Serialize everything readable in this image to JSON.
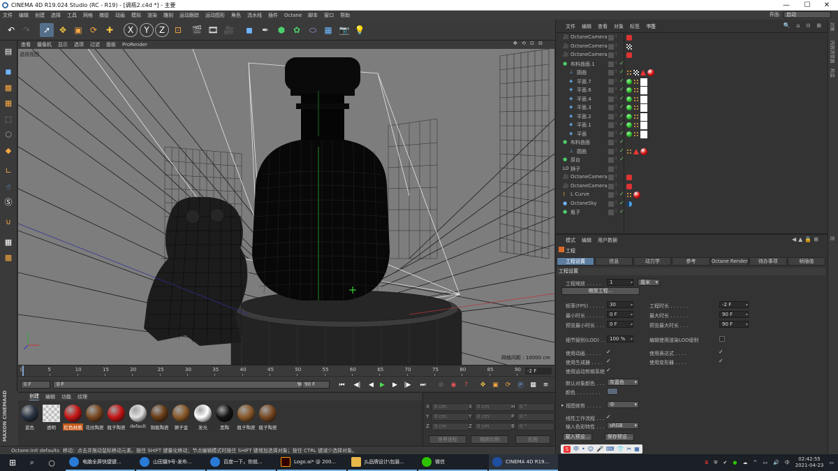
{
  "window": {
    "title": "CINEMA 4D R19.024 Studio (RC - R19) - [调瓶2.c4d *] - 主要",
    "min": "—",
    "max": "☐",
    "close": "✕"
  },
  "menu": [
    "文件",
    "编辑",
    "创建",
    "选择",
    "工具",
    "网格",
    "捕捉",
    "动画",
    "模拟",
    "渲染",
    "雕刻",
    "运动跟踪",
    "运动图形",
    "角色",
    "流水线",
    "插件",
    "Octane",
    "脚本",
    "窗口",
    "帮助"
  ],
  "interface": {
    "label": "界面:",
    "value": "启动"
  },
  "viewport": {
    "menu": [
      "查看",
      "摄像机",
      "显示",
      "选项",
      "过滤",
      "面板",
      "ProRender"
    ],
    "nav": "✥ ⟲ ⊡ ⊟",
    "label": "透视视图",
    "grid_space": "网格间距 : 10000 cm"
  },
  "timeline": {
    "ticks": [
      "0",
      "5",
      "10",
      "15",
      "20",
      "25",
      "30",
      "35",
      "40",
      "45",
      "50",
      "55",
      "60",
      "65",
      "70",
      "75",
      "80",
      "85",
      "90"
    ],
    "current_frame": "-2 F"
  },
  "playback": {
    "start": "0 F",
    "range_start": "0 F",
    "range_end": "90 F",
    "end": "90 F"
  },
  "materials": {
    "menu": [
      "创建",
      "编辑",
      "功能",
      "纹理"
    ],
    "items": [
      {
        "label": "蓝色",
        "color": "#2a3442",
        "active": false
      },
      {
        "label": "透明",
        "color": "checker",
        "active": false
      },
      {
        "label": "红色材质",
        "color": "#c81818",
        "active": true
      },
      {
        "label": "花纹陶瓷",
        "color": "#7a4a22",
        "active": false
      },
      {
        "label": "瓶子陶瓷",
        "color": "#c81818",
        "active": false
      },
      {
        "label": "default",
        "color": "#e0e0e0",
        "active": false
      },
      {
        "label": "铜瓶陶瓷",
        "color": "#6b3e18",
        "active": false
      },
      {
        "label": "狮子金",
        "color": "#8a5a2a",
        "active": false
      },
      {
        "label": "发光",
        "color": "#ffffff",
        "active": false
      },
      {
        "label": "黑陶",
        "color": "#151515",
        "active": false
      },
      {
        "label": "瓶子陶瓷",
        "color": "#8a5a2a",
        "active": false
      },
      {
        "label": "瓶子陶瓷",
        "color": "#7a4a22",
        "active": false
      }
    ]
  },
  "coords": {
    "rows": [
      {
        "a": "X",
        "av": "0 cm",
        "b": "X",
        "bv": "0 cm",
        "c": "H",
        "cv": "0 °"
      },
      {
        "a": "Y",
        "av": "0 cm",
        "b": "Y",
        "bv": "0 cm",
        "c": "P",
        "cv": "0 °"
      },
      {
        "a": "Z",
        "av": "0 cm",
        "b": "Z",
        "bv": "0 cm",
        "c": "B",
        "cv": "0 °"
      }
    ],
    "mode1": "世界坐标",
    "mode2": "缩放比例",
    "apply": "应用"
  },
  "status": {
    "left": "Octane:init defaults",
    "message": "移动：点击并拖动鼠标移动元素。按住 SHIFT 键量化移动；节点编辑模式时按住 SHIFT 键增加选择对象；按住 CTRL 键减少选择对象。"
  },
  "objects": {
    "menu": [
      "文件",
      "编辑",
      "查看",
      "对象",
      "标签",
      "书签"
    ],
    "icons": "🔍 ⌂ ⊙ ⊞",
    "rows": [
      {
        "name": "OctaneCamera",
        "indent": 0,
        "type": "camera",
        "tags": [
          "cam"
        ]
      },
      {
        "name": "OctaneCamera",
        "indent": 0,
        "type": "camera",
        "tags": [
          "check"
        ]
      },
      {
        "name": "OctaneCamera",
        "indent": 0,
        "type": "camera",
        "tags": [
          "cam"
        ]
      },
      {
        "name": "布料曲面.1",
        "indent": 0,
        "type": "cloth",
        "tags": []
      },
      {
        "name": "圆曲",
        "indent": 1,
        "type": "shape",
        "tags": [
          "dots",
          "checker",
          "tri",
          "red"
        ]
      },
      {
        "name": "平面.7",
        "indent": 1,
        "type": "plane",
        "tags": [
          "green",
          "dots",
          "white"
        ]
      },
      {
        "name": "平面.6",
        "indent": 1,
        "type": "plane",
        "tags": [
          "green",
          "dots",
          "white"
        ]
      },
      {
        "name": "平面.4",
        "indent": 1,
        "type": "plane",
        "tags": [
          "green",
          "dots",
          "white"
        ]
      },
      {
        "name": "平面.3",
        "indent": 1,
        "type": "plane",
        "tags": [
          "green",
          "dots",
          "white"
        ]
      },
      {
        "name": "平面.2",
        "indent": 1,
        "type": "plane",
        "tags": [
          "green",
          "dots",
          "white"
        ]
      },
      {
        "name": "平面.1",
        "indent": 1,
        "type": "plane",
        "tags": [
          "green",
          "dots",
          "white"
        ]
      },
      {
        "name": "平面",
        "indent": 1,
        "type": "plane",
        "tags": [
          "green",
          "dots",
          "white"
        ]
      },
      {
        "name": "布料曲面",
        "indent": 0,
        "type": "cloth",
        "tags": []
      },
      {
        "name": "圆曲",
        "indent": 1,
        "type": "shape",
        "tags": [
          "dots",
          "tri",
          "red"
        ]
      },
      {
        "name": "原台",
        "indent": 0,
        "type": "cloth",
        "tags": []
      },
      {
        "name": "狮子",
        "indent": 0,
        "type": "null",
        "tags": []
      },
      {
        "name": "OctaneCamera",
        "indent": 0,
        "type": "camera",
        "tags": [
          "cam"
        ]
      },
      {
        "name": "OctaneCamera",
        "indent": 0,
        "type": "camera",
        "tags": [
          "cam"
        ]
      },
      {
        "name": "L Curve",
        "indent": 0,
        "type": "curve",
        "tags": [
          "dots",
          "red"
        ]
      },
      {
        "name": "OctaneSky",
        "indent": 0,
        "type": "sky",
        "tags": [
          "sky"
        ]
      },
      {
        "name": "瓶子",
        "indent": 0,
        "type": "cloth",
        "tags": []
      }
    ]
  },
  "attributes": {
    "menu": [
      "模式",
      "编辑",
      "用户数据"
    ],
    "title": "工程",
    "tabs": [
      "工程设置",
      "信息",
      "动力学",
      "参考",
      "Octane Render",
      "待办事项",
      "帧插值"
    ],
    "section": "工程设置",
    "scale_label": "工程缩放 . . . . .",
    "scale_value": "1",
    "scale_unit": "厘米",
    "scale_button": "缩放工程...",
    "fps_label": "帧率(FPS) . . . . .",
    "fps_value": "30",
    "project_time_label": "工程时长 . . . . . .",
    "project_time_value": "-2 F",
    "min_time_label": "最小时长 . . . . . .",
    "min_time_value": "0 F",
    "max_time_label": "最大时长 . . . . . .",
    "max_time_value": "90 F",
    "preview_min_label": "预览最小时长 . . .",
    "preview_min_value": "0 F",
    "preview_max_label": "预览最大时长 . . .",
    "preview_max_value": "90 F",
    "lod_label": "细节级别(LOD) . . .",
    "lod_value": "100 %",
    "render_lod_label": "编辑使用渲染LOD级别",
    "use_anim_label": "使用动画 . . . . .",
    "use_expr_label": "使用表达式 . . . .",
    "use_gen_label": "使用生成器 . . . .",
    "use_deform_label": "使用变形器 . . . .",
    "use_motion_label": "使用运动剪辑系统",
    "default_color_label": "默认对象颜色 . . .",
    "default_color_value": "灰蓝色",
    "color_label": "颜色 . . . . . . . .",
    "view_clip_label": "视图修剪 . . . . .",
    "view_clip_value": "中",
    "linear_label": "线性工作流程 . . .",
    "input_color_label": "输入色彩特性 . . .",
    "input_color_value": "sRGB",
    "load_preset": "载入预设...",
    "save_preset": "保存预设..."
  },
  "right_tabs": [
    "对象",
    "内容浏览器",
    "构造",
    "层"
  ],
  "ime": [
    "中",
    "•",
    "☺",
    "🎤",
    "⌨",
    "👕",
    "✂",
    "▦"
  ],
  "taskbar": {
    "items": [
      {
        "label": "电脑全屏快捷键...",
        "color": "#2a7bd6",
        "state": "open"
      },
      {
        "label": "山田摄9号-发布...",
        "color": "#2a7bd6",
        "state": "open"
      },
      {
        "label": "百度一下，你就...",
        "color": "#2a7bd6",
        "state": "open"
      },
      {
        "label": "Logo.ai* @ 200...",
        "color": "#330000",
        "state": "open"
      },
      {
        "label": "JL品牌设计\\包装...",
        "color": "#e8b84a",
        "state": "open"
      },
      {
        "label": "微信",
        "color": "#2dc100",
        "state": "open"
      },
      {
        "label": "CINEMA 4D R19...",
        "color": "#1f4fa0",
        "state": "active"
      }
    ],
    "time": "02:42:55",
    "date": "2021-04-23",
    "lang": "中"
  }
}
